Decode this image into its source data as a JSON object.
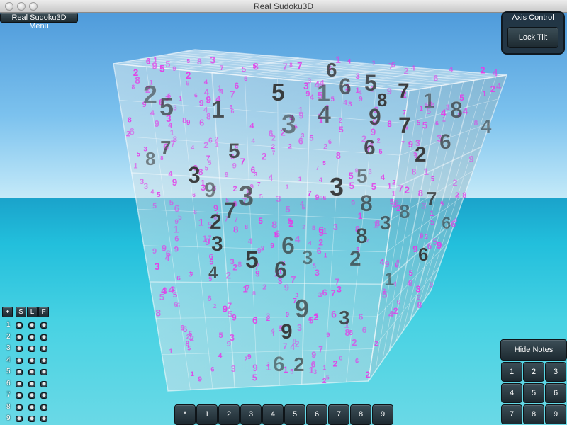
{
  "window": {
    "title": "Real Sudoku3D"
  },
  "menu": {
    "label": "Real Sudoku3D Menu"
  },
  "axis_control": {
    "title": "Axis Control",
    "lock_label": "Lock Tilt"
  },
  "file_panel": {
    "headers": [
      "+",
      "S",
      "L",
      "F"
    ],
    "rows": [
      "1",
      "2",
      "3",
      "4",
      "5",
      "6",
      "7",
      "8",
      "9"
    ]
  },
  "bottom_bar": {
    "buttons": [
      "*",
      "1",
      "2",
      "3",
      "4",
      "5",
      "6",
      "7",
      "8",
      "9"
    ]
  },
  "notes_panel": {
    "hide_label": "Hide Notes",
    "numbers": [
      "1",
      "2",
      "3",
      "4",
      "5",
      "6",
      "7",
      "8",
      "9"
    ]
  },
  "cube": {
    "big_digits": [
      "2",
      "5",
      "1",
      "5",
      "1",
      "6",
      "5",
      "7",
      "1",
      "8",
      "6",
      "8",
      "3",
      "4",
      "9",
      "7",
      "4",
      "6",
      "6",
      "2",
      "8",
      "7",
      "5",
      "3",
      "9",
      "3",
      "7",
      "3",
      "5",
      "8",
      "7",
      "2",
      "8",
      "3",
      "8",
      "3",
      "6",
      "6",
      "6",
      "5",
      "3",
      "2",
      "4",
      "6",
      "1",
      "9",
      "3",
      "9",
      "6",
      "2"
    ],
    "note_color": "#e43be8"
  },
  "colors": {
    "button_top": "#3c4e57",
    "button_bottom": "#1d2a31",
    "sky": "#7cc2ee",
    "sea": "#22bfdc"
  }
}
